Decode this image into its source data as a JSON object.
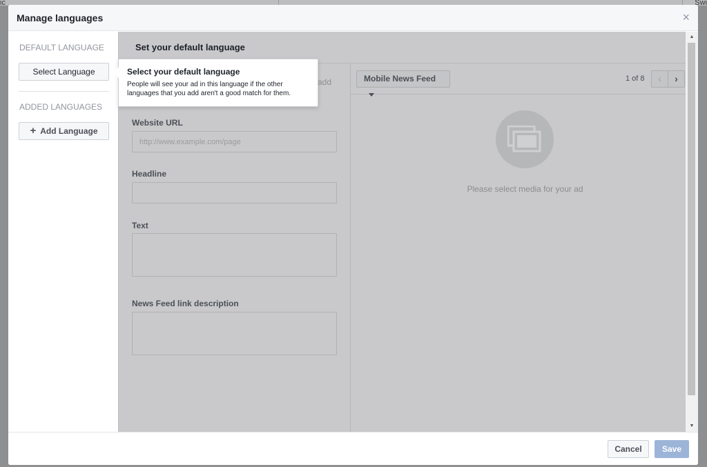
{
  "background": {
    "left_fragment": "ic",
    "right_fragment": "Swi"
  },
  "modal": {
    "title": "Manage languages",
    "close_label": "×"
  },
  "sidebar": {
    "default_heading": "DEFAULT LANGUAGE",
    "select_language_label": "Select Language",
    "added_heading": "ADDED LANGUAGES",
    "add_language_label": "Add Language",
    "add_icon": "+"
  },
  "main": {
    "title": "Set your default language",
    "partial_text": "add",
    "fields": {
      "website_url_label": "Website URL",
      "website_url_placeholder": "http://www.example.com/page",
      "headline_label": "Headline",
      "text_label": "Text",
      "link_description_label": "News Feed link description"
    }
  },
  "preview": {
    "placement_label": "Mobile News Feed",
    "pager_text": "1 of 8",
    "prev_icon": "‹",
    "next_icon": "›",
    "media_text": "Please select media for your ad"
  },
  "tooltip": {
    "title": "Select your default language",
    "body": "People will see your ad in this language if the other languages that you add aren't a good match for them."
  },
  "footer": {
    "cancel_label": "Cancel",
    "save_label": "Save"
  },
  "colors": {
    "save_button": "#9cb4d8",
    "overlay": "#c9c9cb",
    "header": "#f6f7f9"
  }
}
